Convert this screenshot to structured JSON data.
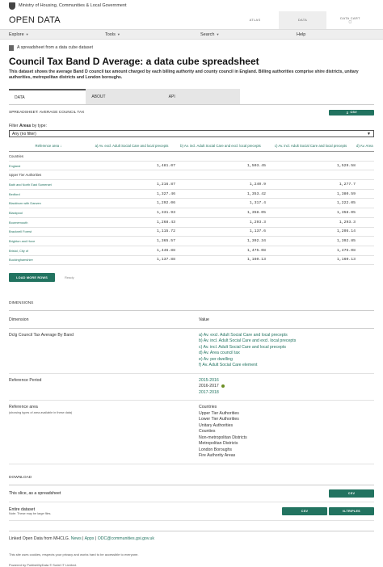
{
  "header": {
    "department": "Ministry of Housing, Communities & Local Government",
    "brand": "OPEN DATA",
    "modes": [
      "ATLAS",
      "DATA",
      "DATA CART"
    ]
  },
  "nav": [
    "Explore",
    "Tools",
    "Search",
    "Help"
  ],
  "breadcrumb": "A spreadsheet from a data cube dataset",
  "title": "Council Tax Band D Average: a data cube spreadsheet",
  "description": "This dataset shows the average Band D council tax amount charged by each billing authority and county council in England. Billing authorities comprise shire districts, unitary authorities, metropolitan districts and London boroughs.",
  "tabs": [
    "DATA",
    "ABOUT",
    "API"
  ],
  "spreadsheet": {
    "label": "SPREADSHEET: AVERAGE COUNCIL TAX",
    "download_button": "CSV",
    "filter_label_pre": "Filter ",
    "filter_label_bold": "Areas",
    "filter_label_post": " by type:",
    "filter_value": "Any (no filter)",
    "columns": [
      "Reference area",
      "a) Av. excl. Adult Social Care and local precepts",
      "b) Av. incl. Adult Social Care and excl. local precepts",
      "c) Av. incl. Adult Social Care and local precepts",
      "d) Av. Area"
    ],
    "rows": [
      {
        "area": "Countries",
        "group": true,
        "a": "",
        "b": "",
        "c": ""
      },
      {
        "area": "England",
        "group": false,
        "a": "1,481.07",
        "b": "1,503.45",
        "c": "1,529.58"
      },
      {
        "area": "Upper Tier Authorities",
        "group": true,
        "a": "",
        "b": "",
        "c": ""
      },
      {
        "area": "Bath and North East Somerset",
        "group": false,
        "a": "1,216.87",
        "b": "1,240.9",
        "c": "1,277.7"
      },
      {
        "area": "Bedford",
        "group": false,
        "a": "1,327.46",
        "b": "1,353.42",
        "c": "1,380.59"
      },
      {
        "area": "Blackburn with Darwen",
        "group": false,
        "a": "1,292.06",
        "b": "1,317.4",
        "c": "1,222.05"
      },
      {
        "area": "Blackpool",
        "group": false,
        "a": "1,331.93",
        "b": "1,358.05",
        "c": "1,358.05"
      },
      {
        "area": "Bournemouth",
        "group": false,
        "a": "1,268.43",
        "b": "1,293.3",
        "c": "1,293.3"
      },
      {
        "area": "Bracknell Forest",
        "group": false,
        "a": "1,115.72",
        "b": "1,137.6",
        "c": "1,205.14"
      },
      {
        "area": "Brighton and Hove",
        "group": false,
        "a": "1,365.57",
        "b": "1,392.34",
        "c": "1,392.85"
      },
      {
        "area": "Bristol, City of",
        "group": false,
        "a": "1,446.88",
        "b": "1,475.08",
        "c": "1,475.08"
      },
      {
        "area": "Buckinghamshire",
        "group": false,
        "a": "1,137.88",
        "b": "1,160.13",
        "c": "1,160.13"
      }
    ],
    "load_more": "LOAD MORE ROWS",
    "status": "Ready"
  },
  "dimensions": {
    "heading": "DIMENSIONS",
    "col_dimension": "Dimension",
    "col_value": "Value",
    "rows": [
      {
        "name": "Dclg Council Tax Average By Band",
        "sub": "",
        "values": [
          {
            "text": "a) Av. excl. Adult Social Care and local precepts",
            "link": true
          },
          {
            "text": "b) Av. incl. Adult Social Care and excl. local precepts",
            "link": true
          },
          {
            "text": "c) Av. incl. Adult Social Care and local precepts",
            "link": true
          },
          {
            "text": "d) Av. Area council tax",
            "link": true
          },
          {
            "text": "e) Av. per dwelling",
            "link": true
          },
          {
            "text": "f) Av. Adult Social Care element",
            "link": true
          }
        ]
      },
      {
        "name": "Reference Period",
        "sub": "",
        "values": [
          {
            "text": "2015-2016",
            "link": true
          },
          {
            "text": "2016-2017",
            "link": false,
            "selected": true
          },
          {
            "text": "2017-2018",
            "link": true
          }
        ]
      },
      {
        "name": "Reference area",
        "sub": "(showing types of area available in these data)",
        "values": [
          {
            "text": "Countries",
            "link": false
          },
          {
            "text": "Upper Tier Authorities",
            "link": false
          },
          {
            "text": "Lower Tier Authorities",
            "link": false
          },
          {
            "text": "Unitary Authorities",
            "link": false
          },
          {
            "text": "Counties",
            "link": false
          },
          {
            "text": "Non-metropolitan Districts",
            "link": false
          },
          {
            "text": "Metropolitan Districts",
            "link": false
          },
          {
            "text": "London Boroughs",
            "link": false
          },
          {
            "text": "Fire Authority Areas",
            "link": false
          }
        ]
      }
    ]
  },
  "download": {
    "heading": "DOWNLOAD",
    "slice_label": "This slice, as a spreadsheet",
    "slice_csv": "CSV",
    "entire_label": "Entire dataset",
    "entire_note": "Note: These may be large files.",
    "entire_csv": "CSV",
    "entire_ntriples": "N-TRIPLES"
  },
  "footer": {
    "prefix": "Linked Open Data from MHCLG.",
    "news": "News",
    "apps": "Apps",
    "email": "ODC@communities.gsi.gov.uk",
    "cookies": "This site uses cookies, respects your privacy and works hard to be accessible to everyone.",
    "powered": "Powered by PublishMyData © Swirrl IT Limited."
  },
  "colors": {
    "accent": "#227360",
    "tab_bg": "#e6e6e6"
  }
}
